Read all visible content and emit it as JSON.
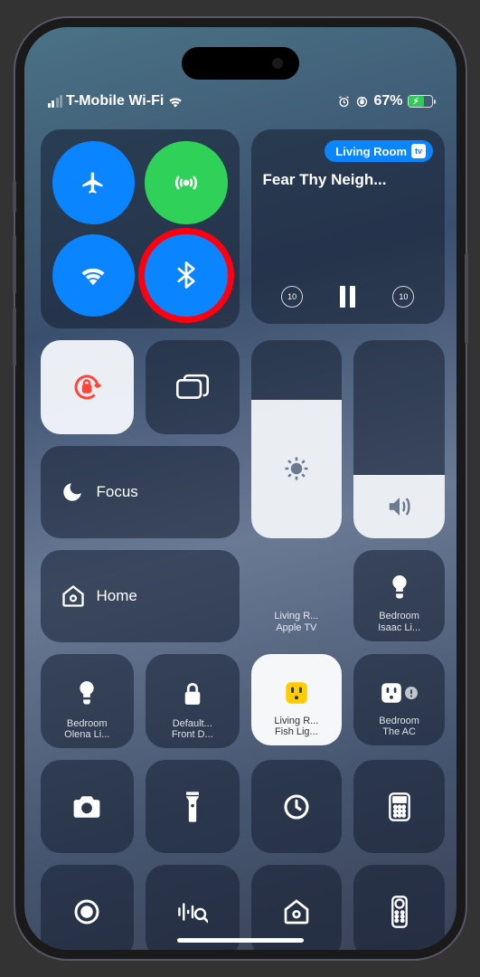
{
  "status": {
    "carrier": "T-Mobile Wi-Fi",
    "battery_pct": "67%"
  },
  "media": {
    "airplay": "Living Room",
    "title": "Fear Thy Neigh...",
    "skip_back": "10",
    "skip_fwd": "10"
  },
  "focus": {
    "label": "Focus"
  },
  "home": {
    "label": "Home"
  },
  "accessories": {
    "a1": {
      "l1": "Living R...",
      "l2": "Apple TV"
    },
    "a2": {
      "l1": "Bedroom",
      "l2": "Isaac Li..."
    },
    "a3": {
      "l1": "Bedroom",
      "l2": "Olena Li..."
    },
    "a4": {
      "l1": "Default...",
      "l2": "Front D..."
    },
    "a5": {
      "l1": "Living R...",
      "l2": "Fish Lig..."
    },
    "a6": {
      "l1": "Bedroom",
      "l2": "The AC"
    }
  }
}
